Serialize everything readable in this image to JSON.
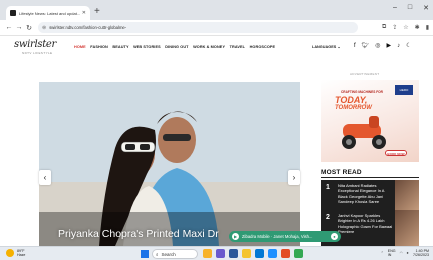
{
  "browser": {
    "tab_title": "Lifestyle News: Latest and updat...",
    "tab_close": "✕",
    "new_tab": "+",
    "window_controls": [
      "–",
      "□",
      "✕"
    ],
    "url": "swirlster.ndtv.com/fashion-cuttr-globalme-",
    "nav_icons": [
      "back-arrow-icon",
      "forward-arrow-icon",
      "reload-icon"
    ],
    "tool_icons": [
      "translate-icon",
      "share-icon",
      "star-icon",
      "extensions-icon",
      "sidebar-icon"
    ]
  },
  "site": {
    "logo": "swirlster",
    "logo_sub": "NDTV LIFESTYLE",
    "nav": [
      "HOME",
      "FASHION",
      "BEAUTY",
      "WEB STORIES",
      "DINING OUT",
      "WORK & MONEY",
      "TRAVEL",
      "HOROSCOPE"
    ],
    "active_nav": "HOME",
    "languages": "LANGUAGES",
    "languages_caret": "⌄",
    "socials": [
      "facebook-icon",
      "twitter-icon",
      "instagram-icon",
      "youtube-icon",
      "bell-icon",
      "moon-icon"
    ]
  },
  "hero": {
    "headline": "Priyanka Chopra's Printed Maxi Dr",
    "prev_label": "‹",
    "next_label": "›"
  },
  "ad": {
    "label": "ADVERTISEMENT",
    "small_text": "CRAFTING MACHINES FOR",
    "big_line1": "TODAY,",
    "big_line2": "TOMORROW",
    "brand": "HERO",
    "cta": "BOOK NOW"
  },
  "most_read": {
    "title": "MOST READ",
    "items": [
      {
        "num": "1",
        "text": "Nita Ambani Radiates Exceptional Elegance In A Black Georgette Abu Jani Sandeep Khosla Saree"
      },
      {
        "num": "2",
        "text": "Janhvi Kapoor Sparkles Brighter In A Rs 4.26 Lakh Holographic Gown For Bawaal Premiere"
      }
    ]
  },
  "pip": {
    "text": "Zibadra Mobile · Janet Mohaja, Vish..."
  },
  "taskbar": {
    "weather_temp": "89°F",
    "weather_desc": "Haze",
    "search_placeholder": "Search",
    "search_icon": "search-icon",
    "tray_lang": "ENG",
    "tray_region": "IN",
    "time": "1:40 PM",
    "date": "7/26/2023"
  },
  "colors": {
    "accent": "#d2322d",
    "pip_green": "#2f9a74",
    "taskbar_bg": "#e6ebf1"
  }
}
